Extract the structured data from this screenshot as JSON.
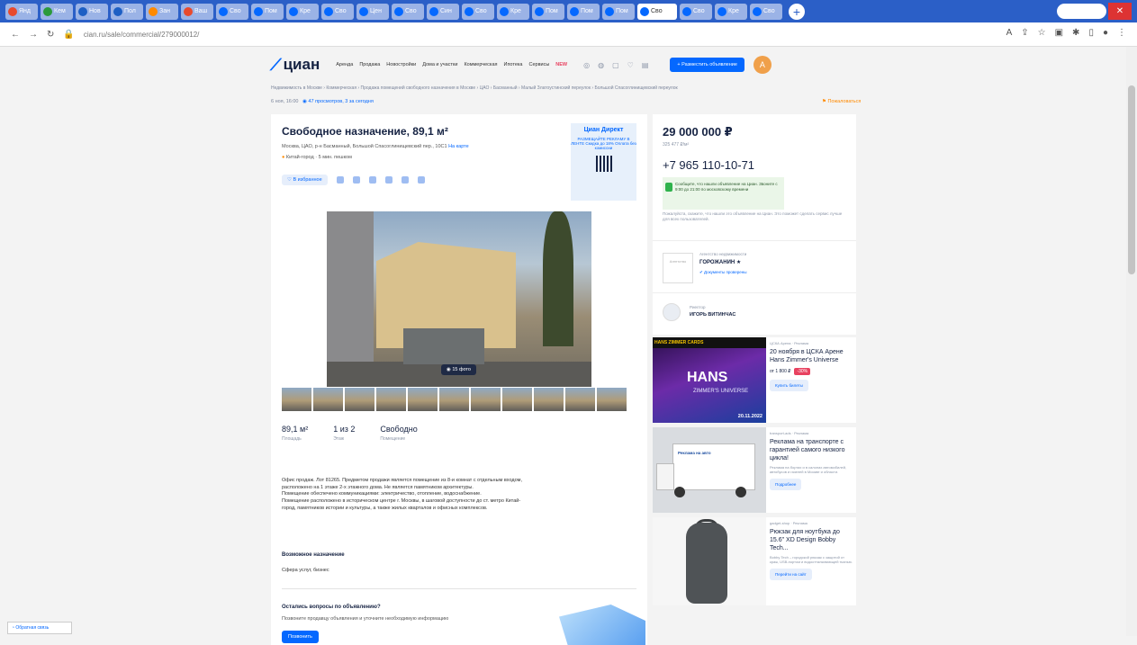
{
  "browser": {
    "tabs": [
      {
        "label": "Янд",
        "color": "#e84a2d"
      },
      {
        "label": "Кем",
        "color": "#2b9a3b"
      },
      {
        "label": "Нов",
        "color": "#1d5fc4"
      },
      {
        "label": "Пол",
        "color": "#1d5fc4"
      },
      {
        "label": "Зан",
        "color": "#ff8a00"
      },
      {
        "label": "Ваш",
        "color": "#e84a2d"
      },
      {
        "label": "Сво",
        "color": "#0468ff"
      },
      {
        "label": "Пом",
        "color": "#0468ff"
      },
      {
        "label": "Кре",
        "color": "#0468ff"
      },
      {
        "label": "Сво",
        "color": "#0468ff"
      },
      {
        "label": "Цен",
        "color": "#0468ff"
      },
      {
        "label": "Сво",
        "color": "#0468ff"
      },
      {
        "label": "Син",
        "color": "#0468ff"
      },
      {
        "label": "Сво",
        "color": "#0468ff"
      },
      {
        "label": "Кре",
        "color": "#0468ff"
      },
      {
        "label": "Пом",
        "color": "#0468ff"
      },
      {
        "label": "Пом",
        "color": "#0468ff"
      },
      {
        "label": "Пом",
        "color": "#0468ff"
      },
      {
        "label": "Сво",
        "color": "#0468ff"
      },
      {
        "label": "Сво",
        "color": "#0468ff"
      },
      {
        "label": "Кре",
        "color": "#0468ff"
      },
      {
        "label": "Сво",
        "color": "#0468ff"
      }
    ],
    "active_tab": "Сво",
    "new_tab": "+",
    "close": "✕",
    "url": "cian.ru/sale/commercial/279000012/"
  },
  "header": {
    "logo": "циан",
    "nav": [
      "Аренда",
      "Продажа",
      "Новостройки",
      "Дома и участки",
      "Коммерческая",
      "Ипотека",
      "Сервисы"
    ],
    "new_badge": "NEW",
    "post_button": "+ Разместить объявление",
    "avatar_initial": "А"
  },
  "breadcrumb": "Недвижимость в Москве › Коммерческая › Продажа помещений свободного назначения в Москве › ЦАО › Басманный › Малый Златоустинский переулок › Большой Спасоглинищевский переулок",
  "meta": {
    "date": "6 ноя, 16:00",
    "views": "47 просмотров, 3 за сегодня",
    "complain": "Пожаловаться"
  },
  "listing": {
    "title": "Свободное назначение, 89,1 м²",
    "address": "Москва, ЦАО, р-н Басманный, Большой Спасоглинищевский пер., 10С1",
    "map_link": "На карте",
    "metro_name": "Китай-город",
    "metro_time": "5 мин. пешком",
    "favorite": "В избранное",
    "photo_count": "15 фото",
    "facts": [
      {
        "value": "89,1 м²",
        "label": "Площадь"
      },
      {
        "value": "1 из 2",
        "label": "Этаж"
      },
      {
        "value": "Свободно",
        "label": "Помещение"
      }
    ],
    "description": [
      "Офис продаж. Лот 81265. Предметом продажи является помещение из 8-и комнат с отдельным входом,",
      "расположено на 1 этаже 2-х этажного дома. Не является памятником архитектуры.",
      "Помещение обеспечено коммуникациями: электричество, отопление, водоснабжение.",
      "Помещение расположено в историческом центре г. Москвы, в шаговой доступности до ст. метро Китай-",
      "город, памятников истории и культуры, а также жилых кварталов и офисных комплексов."
    ],
    "purpose_title": "Возможное назначение",
    "purpose_value": "Сфера услуг, бизнес",
    "question_title": "Остались вопросы по объявлению?",
    "question_text": "Позвоните продавцу объявления и уточните необходимую информацию",
    "question_button": "Позвонить"
  },
  "promo": {
    "brand": "Циан Директ",
    "text": "РАЗМЕЩАЙТЕ РЕКЛАМУ В ЛЕНТЕ Скидка до 18% Оплата без комиссии"
  },
  "sidebar": {
    "price": "29 000 000 ₽",
    "price_sub": "325 477 ₽/м²",
    "phone": "+7 965 110-10-71",
    "safe_text": "Сообщите, что нашли объявление на Циан. Звоните с 9:00 до 21:00 по московскому времени",
    "note": "Пожалуйста, скажите, что нашли это объявление на Циан. Это поможет сделать сервис лучше для всех пользователей.",
    "agency_logo": "Агентство",
    "agency_role": "Агентство недвижимости",
    "agency_name": "ГОРОЖАНИН ★",
    "agency_docs": "Документы проверены",
    "agent_role": "Риелтор",
    "agent_name": "ИГОРЬ ВИТИНЧАС"
  },
  "ads": [
    {
      "top": "HANS ZIMMER CARDS",
      "name": "HANS",
      "sub": "ZIMMER'S UNIVERSE",
      "date": "20.11.2022",
      "source": "ЦСКА Арена · Реклама",
      "title": "20 ноября в ЦСКА Арене Hans Zimmer's Universe",
      "price": "от 1 800 ₽",
      "sale": "-30%",
      "button": "Купить билеты"
    },
    {
      "logo": "Реклама на авто",
      "source": "transport-ads · Реклама",
      "title": "Реклама на транспорте с гарантией самого низкого цикла!",
      "body": "Реклама на бортах и в салонах автомобилей, автобусов и газелей в Москве и области.",
      "button": "Подробнее"
    },
    {
      "source": "gadget-shop · Реклама",
      "title": "Рюкзак для ноутбука до 15.6\" XD Design Bobby Tech...",
      "body": "Bobby Tech – городской рюкзак с защитой от краж, USB-портом и водоотталкивающей тканью.",
      "button": "Перейти на сайт"
    }
  ],
  "feedback": "Обратная связь"
}
